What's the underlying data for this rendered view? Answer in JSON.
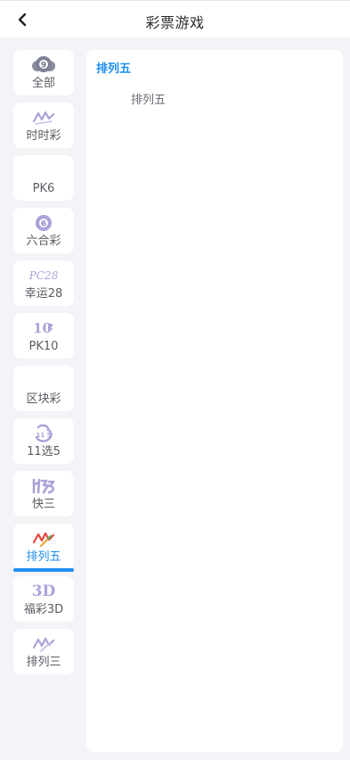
{
  "header": {
    "title": "彩票游戏"
  },
  "sidebar": {
    "items": [
      {
        "label": "全部",
        "icon": "billiard-ball-9-icon"
      },
      {
        "label": "时时彩",
        "icon": "shishicai-logo-icon"
      },
      {
        "label": "PK6",
        "icon": ""
      },
      {
        "label": "六合彩",
        "icon": "ball-6-icon"
      },
      {
        "label": "幸运28",
        "icon": "pc28-logo-icon"
      },
      {
        "label": "PK10",
        "icon": "pk10-logo-icon"
      },
      {
        "label": "区块彩",
        "icon": ""
      },
      {
        "label": "11选5",
        "icon": "11x5-logo-icon"
      },
      {
        "label": "快三",
        "icon": "kuaisan-logo-icon"
      },
      {
        "label": "排列五",
        "icon": "pailiewu-logo-icon",
        "active": true
      },
      {
        "label": "福彩3D",
        "icon": "3d-logo-icon"
      },
      {
        "label": "排列三",
        "icon": "pailiesan-logo-icon"
      }
    ]
  },
  "content": {
    "section_title": "排列五",
    "games": [
      "排列五"
    ]
  },
  "logo_text": {
    "pc28": "PC28",
    "pk10": "10",
    "fc3d": "3D"
  },
  "colors": {
    "accent": "#1e8ef0",
    "icon_purple": "#a9a3d9",
    "label": "#5b5b63",
    "background": "#f3f3f8"
  }
}
